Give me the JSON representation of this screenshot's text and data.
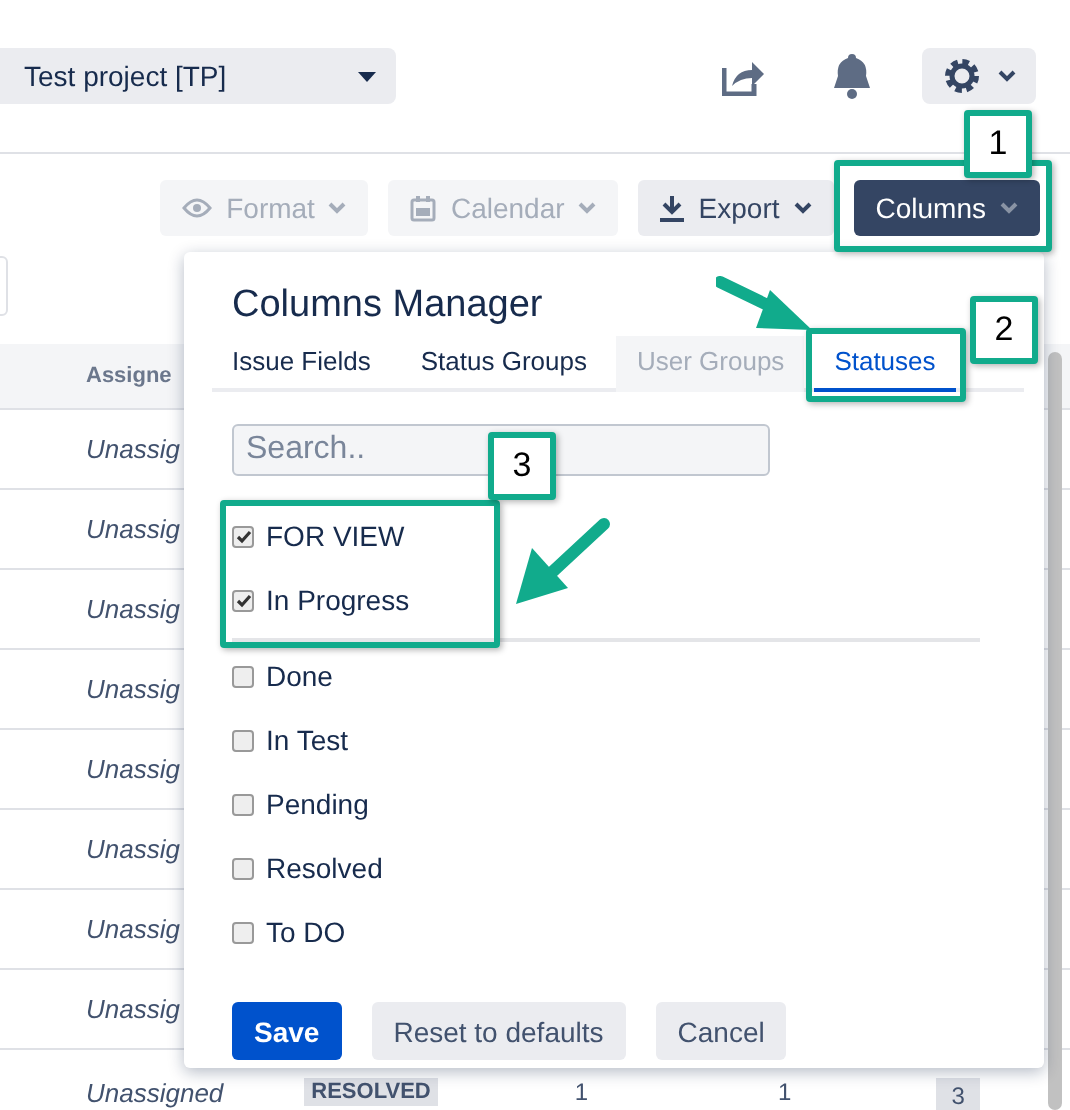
{
  "header": {
    "project_select": "Test project [TP]"
  },
  "toolbar": [
    {
      "label": "Format",
      "kind": "format",
      "disabled": true
    },
    {
      "label": "Calendar",
      "kind": "calendar",
      "disabled": true
    },
    {
      "label": "Export",
      "kind": "export",
      "disabled": false
    },
    {
      "label": "Columns",
      "kind": "columns",
      "disabled": false
    }
  ],
  "table": {
    "columns": [
      "Assigne"
    ],
    "rows": [
      {
        "assignee": "Unassig"
      },
      {
        "assignee": "Unassig"
      },
      {
        "assignee": "Unassig"
      },
      {
        "assignee": "Unassig"
      },
      {
        "assignee": "Unassig"
      },
      {
        "assignee": "Unassig"
      },
      {
        "assignee": "Unassig"
      },
      {
        "assignee": "Unassig"
      },
      {
        "assignee": "Unassigned",
        "status": "RESOLVED",
        "column_3": "1",
        "column_4": "1",
        "column_5": "3"
      }
    ]
  },
  "columns_manager": {
    "title": "Columns Manager",
    "tabs": [
      {
        "label": "Issue Fields",
        "selected": false,
        "disabled": false
      },
      {
        "label": "Status Groups",
        "selected": false,
        "disabled": false
      },
      {
        "label": "User Groups",
        "selected": false,
        "disabled": true
      },
      {
        "label": "Statuses",
        "selected": true,
        "disabled": false
      }
    ],
    "search": {
      "placeholder": "Search.."
    },
    "selected_items": [
      {
        "label": "FOR VIEW",
        "checked": true
      },
      {
        "label": "In Progress",
        "checked": true
      }
    ],
    "other_items": [
      {
        "label": "Done",
        "checked": false
      },
      {
        "label": "In Test",
        "checked": false
      },
      {
        "label": "Pending",
        "checked": false
      },
      {
        "label": "Resolved",
        "checked": false
      },
      {
        "label": "To DO",
        "checked": false
      }
    ],
    "buttons": [
      {
        "label": "Save",
        "kind": "primary"
      },
      {
        "label": "Reset to defaults",
        "kind": "secondary"
      },
      {
        "label": "Cancel",
        "kind": "secondary"
      }
    ]
  },
  "callouts": [
    "1",
    "2",
    "3"
  ]
}
